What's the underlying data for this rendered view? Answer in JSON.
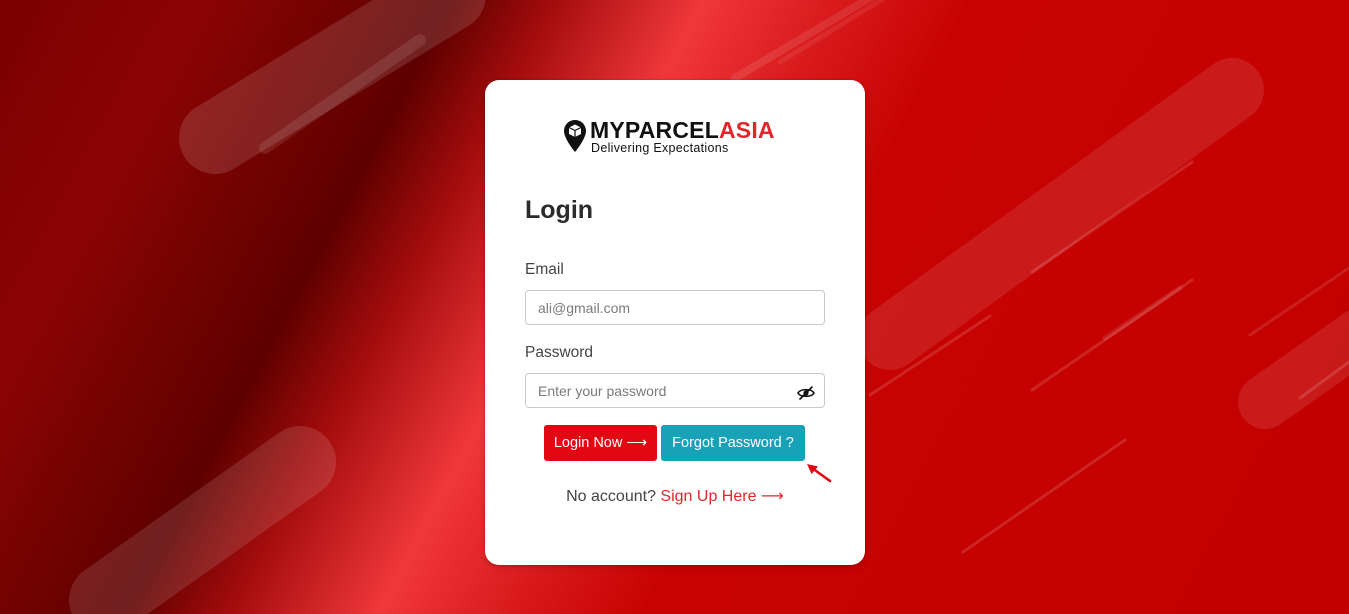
{
  "brand": {
    "name_part1": "MYPARCEL",
    "name_part2": "ASIA",
    "tagline": "Delivering Expectations"
  },
  "login": {
    "title": "Login",
    "email_label": "Email",
    "email_placeholder": "ali@gmail.com",
    "password_label": "Password",
    "password_placeholder": "Enter your password",
    "login_button": "Login Now ⟶",
    "forgot_button": "Forgot Password ?",
    "no_account_text": "No account?",
    "signup_link": "Sign Up Here ⟶"
  },
  "icons": {
    "logo": "map-pin-box-icon",
    "password_toggle": "eye-slash-icon",
    "annotation": "red-arrow-icon"
  },
  "colors": {
    "accent_red": "#e30613",
    "brand_red": "#e3262b",
    "teal": "#17a2b8",
    "background_red": "#c20000"
  }
}
